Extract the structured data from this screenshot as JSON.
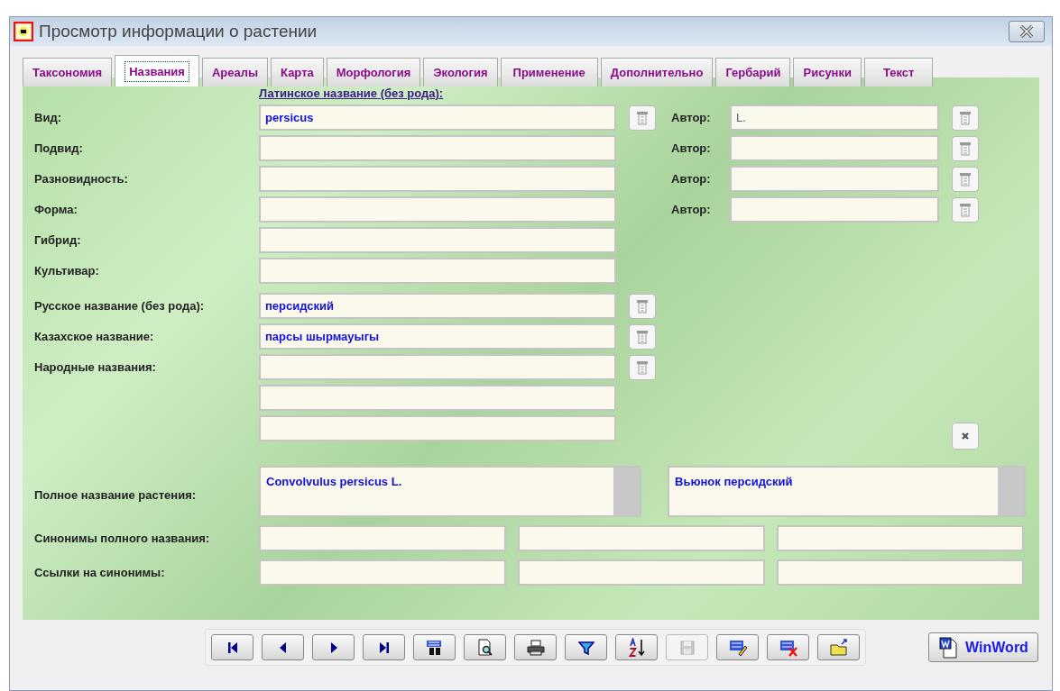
{
  "window": {
    "title": "Просмотр информации о растении"
  },
  "tabs": [
    {
      "label": "Таксономия",
      "selected": false
    },
    {
      "label": "Названия",
      "selected": true
    },
    {
      "label": "Ареалы",
      "selected": false
    },
    {
      "label": "Карта",
      "selected": false
    },
    {
      "label": "Морфология",
      "selected": false
    },
    {
      "label": "Экология",
      "selected": false
    },
    {
      "label": "Применение",
      "selected": false
    },
    {
      "label": "Дополнительно",
      "selected": false
    },
    {
      "label": "Гербарий",
      "selected": false
    },
    {
      "label": "Рисунки",
      "selected": false
    },
    {
      "label": "Текст",
      "selected": false
    }
  ],
  "latin_header": "Латинское название (без рода):",
  "latin_rows": [
    {
      "label": "Вид:",
      "value": "persicus",
      "has_lookup": true,
      "author": {
        "label": "Автор:",
        "value": "L."
      }
    },
    {
      "label": "Подвид:",
      "has_lookup": false,
      "author": {
        "label": "Автор:"
      }
    },
    {
      "label": "Разновидность:",
      "has_lookup": false,
      "author": {
        "label": "Автор:"
      }
    },
    {
      "label": "Форма:",
      "has_lookup": false,
      "author": {
        "label": "Автор:"
      }
    },
    {
      "label": "Гибрид:",
      "has_lookup": false
    },
    {
      "label": "Культивар:",
      "has_lookup": false
    }
  ],
  "name_rows": [
    {
      "label": "Русское название (без рода):",
      "value": "персидский",
      "has_lookup": true
    },
    {
      "label": "Казахское название:",
      "value": "парсы шырмауыгы",
      "has_lookup": true
    },
    {
      "label": "Народные названия:",
      "has_lookup": true
    },
    {
      "has_lookup": false
    },
    {
      "has_lookup": false
    }
  ],
  "full_name": {
    "label": "Полное название растения:",
    "latin": "Convolvulus persicus L.",
    "russian": "Вьюнок персидский"
  },
  "synonym_rows": [
    {
      "label": "Синонимы полного названия:"
    },
    {
      "label": "Ссылки на синонимы:"
    }
  ],
  "toolbar": [
    {
      "kind": "first",
      "disabled": false
    },
    {
      "kind": "prev",
      "disabled": false
    },
    {
      "kind": "next",
      "disabled": false
    },
    {
      "kind": "last",
      "disabled": false
    },
    {
      "kind": "find",
      "disabled": false
    },
    {
      "kind": "preview",
      "disabled": false
    },
    {
      "kind": "print",
      "disabled": false
    },
    {
      "kind": "filter",
      "disabled": false
    },
    {
      "kind": "sort",
      "disabled": false
    },
    {
      "kind": "save",
      "disabled": true
    },
    {
      "kind": "edit",
      "disabled": false
    },
    {
      "kind": "delete",
      "disabled": false
    },
    {
      "kind": "export",
      "disabled": false
    }
  ],
  "winword_button": "WinWord"
}
